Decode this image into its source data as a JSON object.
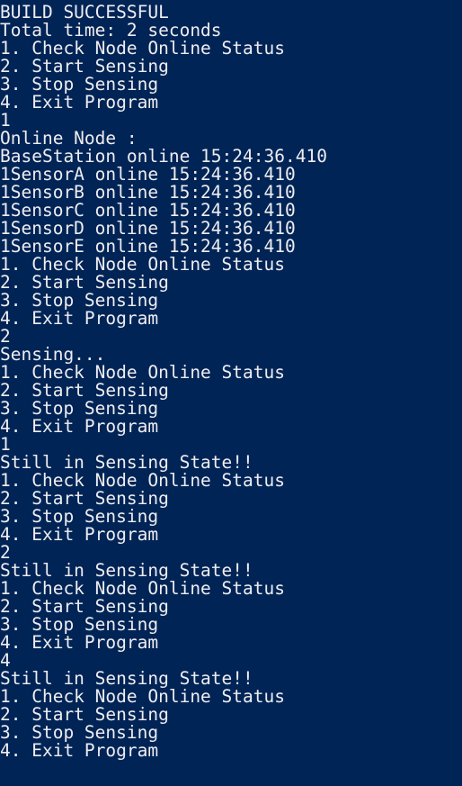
{
  "console": {
    "background_color": "#012456",
    "text_color": "#eeedf0",
    "lines": [
      "BUILD SUCCESSFUL",
      "Total time: 2 seconds",
      "1. Check Node Online Status",
      "2. Start Sensing",
      "3. Stop Sensing",
      "4. Exit Program",
      "1",
      "Online Node :",
      "BaseStation online 15:24:36.410",
      "1SensorA online 15:24:36.410",
      "1SensorB online 15:24:36.410",
      "1SensorC online 15:24:36.410",
      "1SensorD online 15:24:36.410",
      "1SensorE online 15:24:36.410",
      "1. Check Node Online Status",
      "2. Start Sensing",
      "3. Stop Sensing",
      "4. Exit Program",
      "2",
      "Sensing...",
      "1. Check Node Online Status",
      "2. Start Sensing",
      "3. Stop Sensing",
      "4. Exit Program",
      "1",
      "Still in Sensing State!!",
      "1. Check Node Online Status",
      "2. Start Sensing",
      "3. Stop Sensing",
      "4. Exit Program",
      "2",
      "Still in Sensing State!!",
      "1. Check Node Online Status",
      "2. Start Sensing",
      "3. Stop Sensing",
      "4. Exit Program",
      "4",
      "Still in Sensing State!!",
      "1. Check Node Online Status",
      "2. Start Sensing",
      "3. Stop Sensing",
      "4. Exit Program"
    ]
  }
}
